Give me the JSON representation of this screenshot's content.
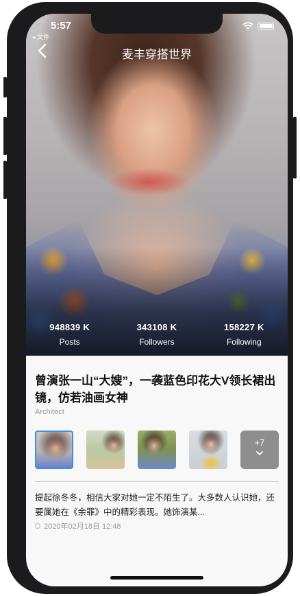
{
  "status_bar": {
    "time": "5:57",
    "back_app": "◂ 文件"
  },
  "nav": {
    "title": "麦丰穿搭世界"
  },
  "stats": [
    {
      "value": "948839 K",
      "label": "Posts"
    },
    {
      "value": "343108 K",
      "label": "Followers"
    },
    {
      "value": "158227 K",
      "label": "Following"
    }
  ],
  "article": {
    "title": "曾演张一山“大嫂”，一袭蓝色印花大V领长裙出镜，仿若油画女神",
    "subtitle": "Architect",
    "more_count": "+7",
    "excerpt": "提起徐冬冬，相信大家对她一定不陌生了。大多数人认识她，还要属她在《余罪》中的精彩表现。她饰演某...",
    "date": "2020年02月18日 12:48"
  },
  "colors": {
    "accent": "#3d8fe0",
    "more_bg": "#8e8e8e",
    "phone_frame": "#1b1b1d"
  }
}
